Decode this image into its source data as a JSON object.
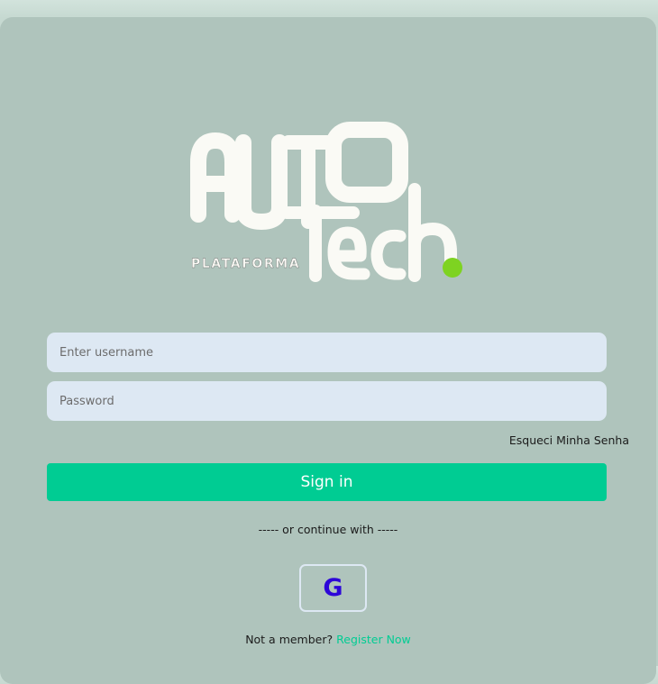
{
  "logo": {
    "text": "AUTO Tech",
    "subtitle": "PLATAFORMA",
    "dot_color": "#7ed321"
  },
  "login": {
    "username_placeholder": "Enter username",
    "password_placeholder": "Password",
    "forgot_label": "Esqueci Minha Senha",
    "signin_label": "Sign in",
    "divider_text": "----- or continue with -----",
    "google_label": "G",
    "not_member_text": "Not a member?",
    "register_label": "Register Now"
  },
  "colors": {
    "accent": "#00cc93",
    "card": "#afc4bc",
    "input_bg": "#dde8f3",
    "google": "#2d06d8"
  }
}
